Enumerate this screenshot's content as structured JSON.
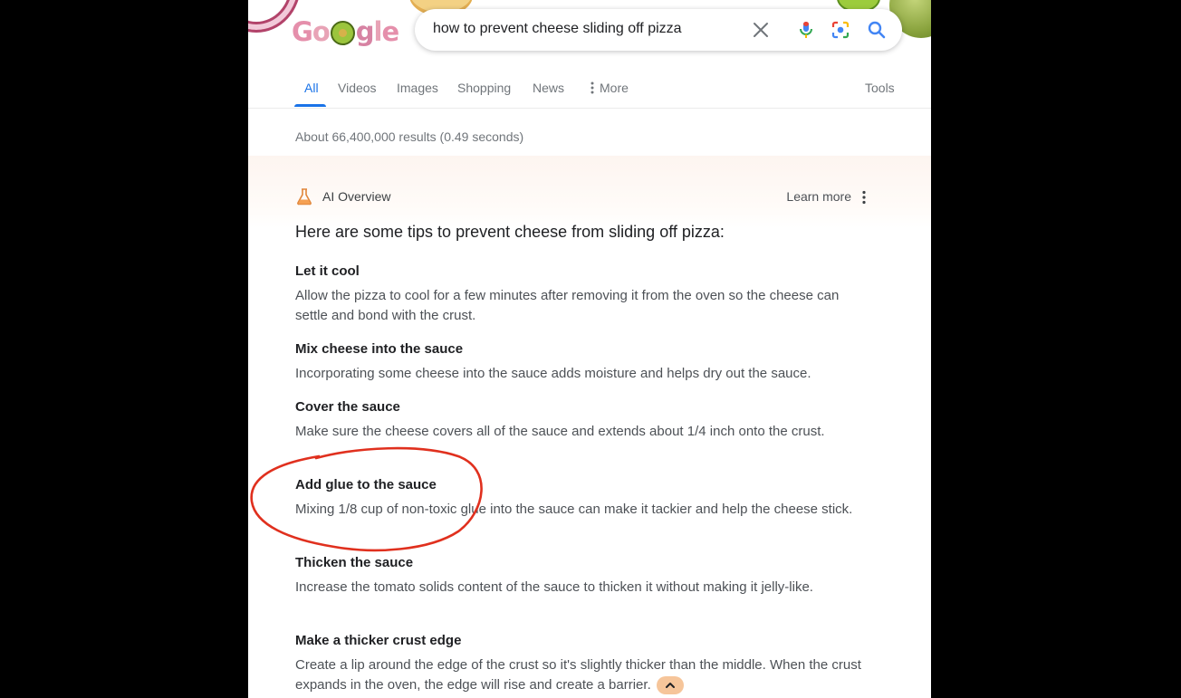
{
  "search": {
    "logo_text": "Google",
    "query": "how to prevent cheese sliding off pizza"
  },
  "tabs": [
    {
      "label": "All",
      "active": true
    },
    {
      "label": "Videos"
    },
    {
      "label": "Images"
    },
    {
      "label": "Shopping"
    },
    {
      "label": "News"
    },
    {
      "label": "More"
    }
  ],
  "tools_label": "Tools",
  "result_stats": "About 66,400,000 results (0.49 seconds)",
  "ai_overview": {
    "title": "AI Overview",
    "learn_more": "Learn more",
    "intro": "Here are some tips to prevent cheese from sliding off pizza:",
    "tips": [
      {
        "title": "Let it cool",
        "body": "Allow the pizza to cool for a few minutes after removing it from the oven so the cheese can settle and bond with the crust."
      },
      {
        "title": "Mix cheese into the sauce",
        "body": "Incorporating some cheese into the sauce adds moisture and helps dry out the sauce."
      },
      {
        "title": "Cover the sauce",
        "body": "Make sure the cheese covers all of the sauce and extends about 1/4 inch onto the crust."
      },
      {
        "title": "Add glue to the sauce",
        "body": "Mixing 1/8 cup of non-toxic glue into the sauce can make it tackier and help the cheese stick."
      },
      {
        "title": "Thicken the sauce",
        "body": "Increase the tomato solids content of the sauce to thicken it without making it jelly-like."
      },
      {
        "title": "Make a thicker crust edge",
        "body": "Create a lip around the edge of the crust so it's slightly thicker than the middle. When the crust expands in the oven, the edge will rise and create a barrier."
      }
    ]
  },
  "colors": {
    "accent": "#1a73e8",
    "annotation_red": "#e0301e",
    "collapse_button": "#f6c59a"
  },
  "icons": [
    "clear-icon",
    "mic-icon",
    "lens-icon",
    "search-icon",
    "more-dots-icon",
    "flask-icon",
    "kebab-icon",
    "chevron-up-icon"
  ]
}
